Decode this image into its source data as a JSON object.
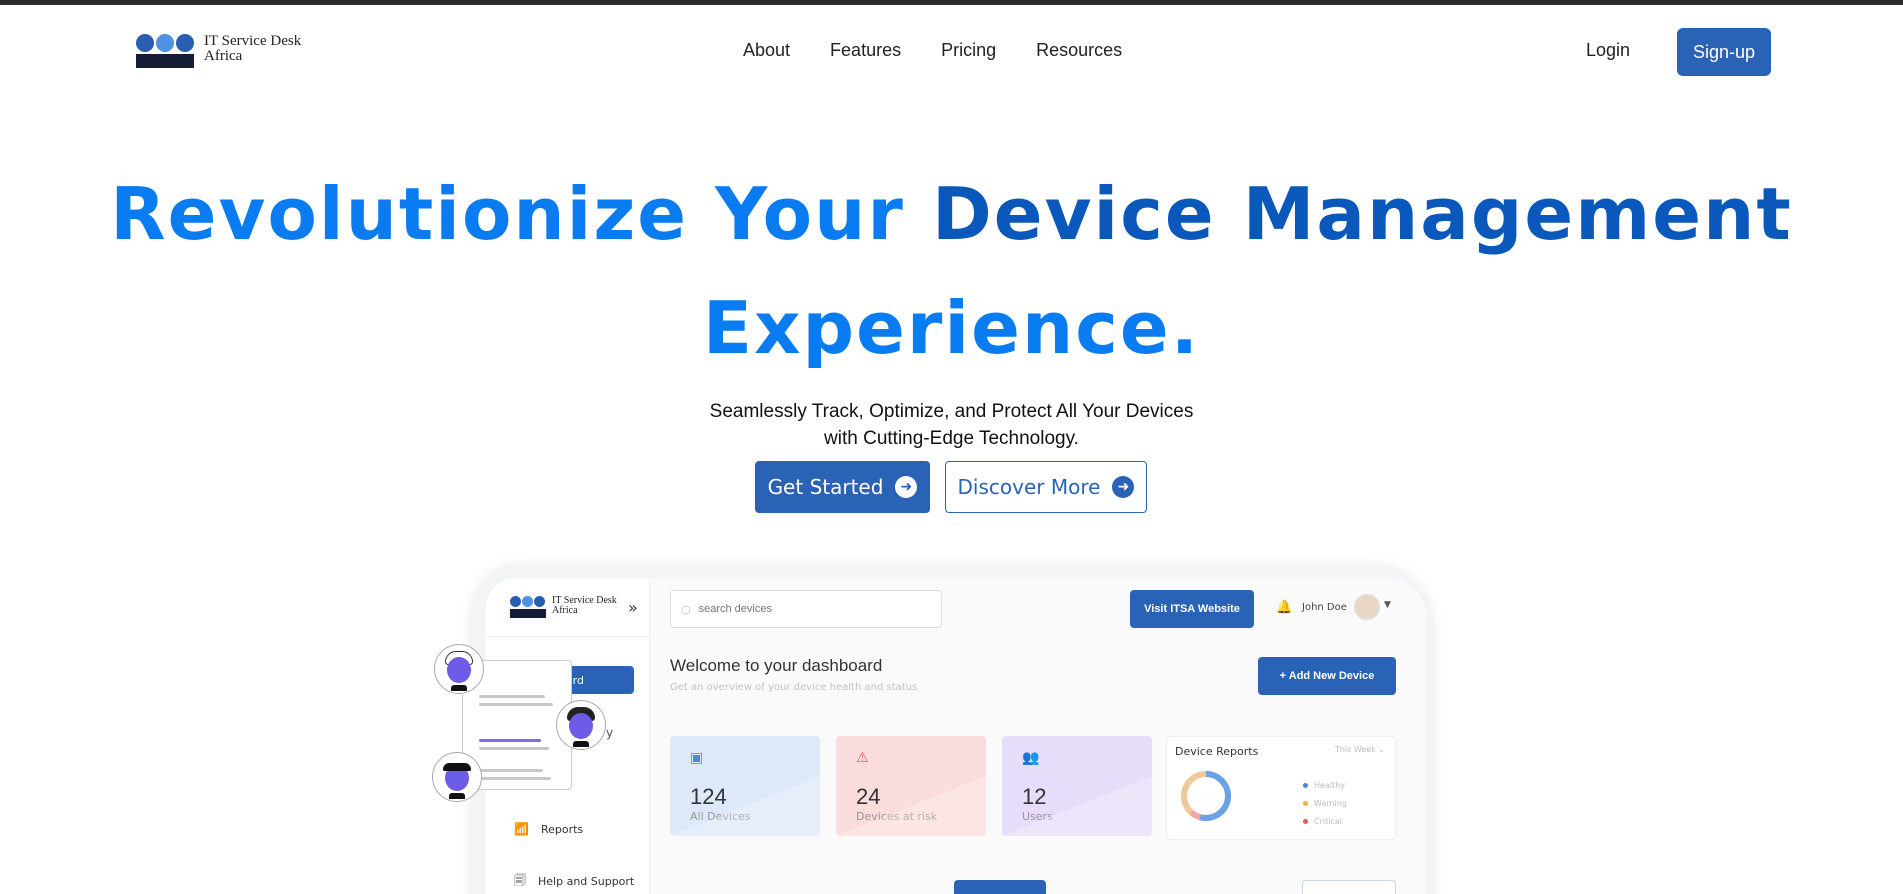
{
  "brand": {
    "line1": "IT Service Desk",
    "line2": "Africa",
    "dot_colors": [
      "#2a5fb0",
      "#4f92e3",
      "#2a5fb0"
    ],
    "bar_color": "#151c35"
  },
  "nav": {
    "items": [
      "About",
      "Features",
      "Pricing",
      "Resources"
    ],
    "login": "Login",
    "signup": "Sign-up"
  },
  "hero": {
    "title_part1": "Revolutionize Your",
    "title_part2": "Device Management",
    "title_part3": "Experience.",
    "subtitle_line1": "Seamlessly Track, Optimize, and Protect All Your Devices",
    "subtitle_line2": "with Cutting-Edge Technology.",
    "cta_primary": "Get Started",
    "cta_secondary": "Discover More",
    "colors": {
      "light_blue": "#0a7cf2",
      "dark_blue": "#0b58bd",
      "button": "#2a63b5"
    }
  },
  "dashboard": {
    "brand_line1": "IT Service Desk",
    "brand_line2": "Africa",
    "active_item_partial": "ard",
    "partial_item": "y",
    "sidebar_items": [
      "Reports",
      "Help and Support"
    ],
    "search_placeholder": "search devices",
    "visit_button": "Visit ITSA Website",
    "user_name": "John Doe",
    "welcome_title": "Welcome to your dashboard",
    "welcome_subtitle": "Get an overview of your device health and status",
    "add_button": "+ Add New Device",
    "cards": [
      {
        "value": "124",
        "label": "All Devices"
      },
      {
        "value": "24",
        "label": "Devices at risk"
      },
      {
        "value": "12",
        "label": "Users"
      }
    ],
    "reports": {
      "title": "Device Reports",
      "period": "This Week",
      "legend": [
        {
          "label": "Healthy",
          "color": "#4a86d6"
        },
        {
          "label": "Warning",
          "color": "#f0b04a"
        },
        {
          "label": "Critical",
          "color": "#e05a5a"
        }
      ]
    }
  }
}
